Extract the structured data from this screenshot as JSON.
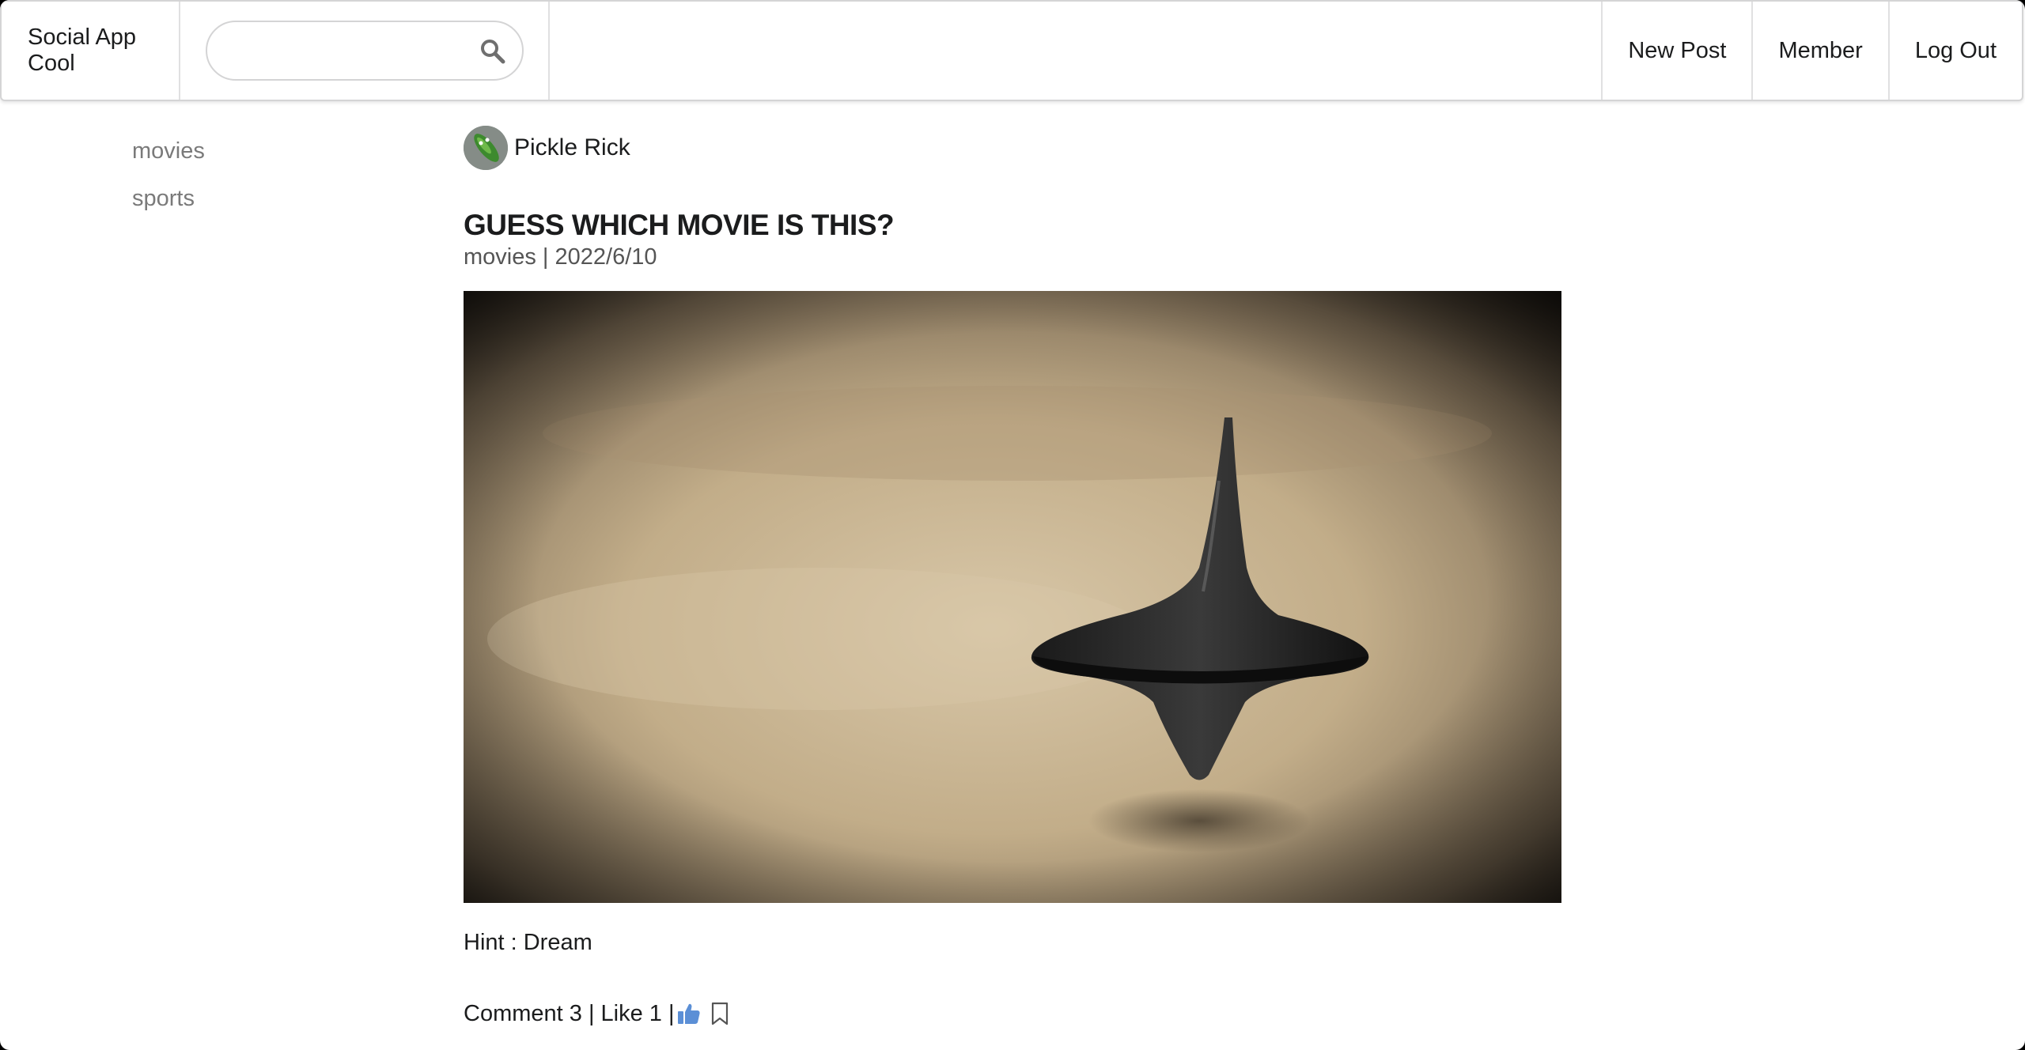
{
  "app": {
    "brand": "Social App Cool"
  },
  "search": {
    "placeholder": "",
    "value": ""
  },
  "nav": {
    "new_post": "New Post",
    "member": "Member",
    "log_out": "Log Out"
  },
  "sidebar": {
    "items": [
      {
        "label": "movies"
      },
      {
        "label": "sports"
      }
    ]
  },
  "post": {
    "author": "Pickle Rick",
    "title": "GUESS WHICH MOVIE IS THIS?",
    "category": "movies",
    "date": "2022/6/10",
    "meta": "movies | 2022/6/10",
    "body": "Hint : Dream",
    "footer": {
      "comments_text": "Comment 3 | Like 1 |"
    }
  },
  "colors": {
    "like_icon": "#5b8fd6",
    "text": "#1b1c1d",
    "sidebar_text": "#7a7a7a"
  }
}
